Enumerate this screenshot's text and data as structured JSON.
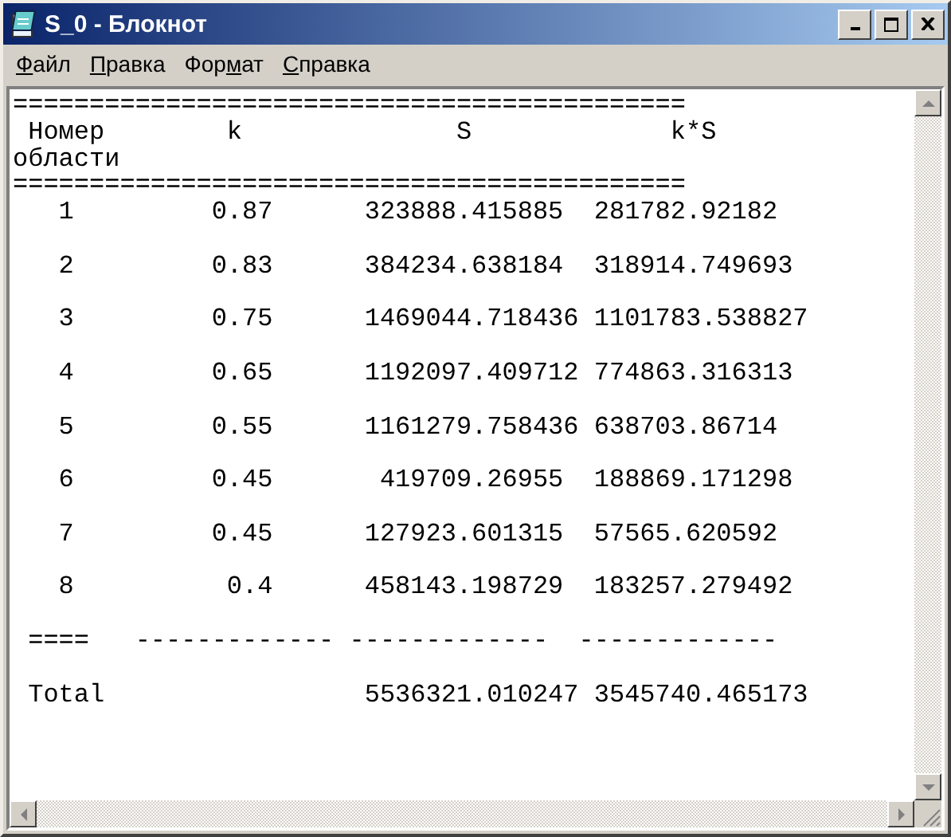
{
  "window": {
    "title": "S_0 - Блокнот"
  },
  "menu": [
    {
      "underlined": "Ф",
      "rest": "айл"
    },
    {
      "underlined": "П",
      "rest": "равка"
    },
    {
      "pre": "Фор",
      "underlined": "м",
      "rest": "ат"
    },
    {
      "underlined": "С",
      "rest": "правка"
    }
  ],
  "document": {
    "header_lines": [
      "============================================",
      " Номер        k              S             k*S",
      "области",
      "============================================"
    ],
    "rows": [
      "   1         0.87      323888.415885  281782.92182",
      "   2         0.83      384234.638184  318914.749693",
      "   3         0.75      1469044.718436 1101783.538827",
      "   4         0.65      1192097.409712 774863.316313",
      "   5         0.55      1161279.758436 638703.86714",
      "   6         0.45       419709.26955  188869.171298",
      "   7         0.45      127923.601315  57565.620592",
      "   8          0.4      458143.198729  183257.279492"
    ],
    "separator": " ====   ------------- -------------  -------------",
    "total": " Total                 5536321.010247 3545740.465173"
  }
}
